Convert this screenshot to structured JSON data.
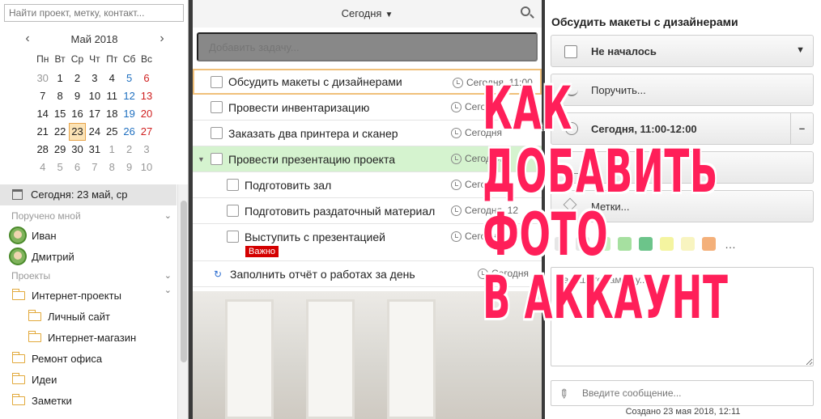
{
  "sidebar": {
    "search_placeholder": "Найти проект, метку, контакт...",
    "calendar": {
      "month_label": "Май 2018",
      "weekdays": [
        "Пн",
        "Вт",
        "Ср",
        "Чт",
        "Пт",
        "Сб",
        "Вс"
      ],
      "weeks": [
        [
          "30",
          "1",
          "2",
          "3",
          "4",
          "5",
          "6"
        ],
        [
          "7",
          "8",
          "9",
          "10",
          "11",
          "12",
          "13"
        ],
        [
          "14",
          "15",
          "16",
          "17",
          "18",
          "19",
          "20"
        ],
        [
          "21",
          "22",
          "23",
          "24",
          "25",
          "26",
          "27"
        ],
        [
          "28",
          "29",
          "30",
          "31",
          "1",
          "2",
          "3"
        ],
        [
          "4",
          "5",
          "6",
          "7",
          "8",
          "9",
          "10"
        ]
      ],
      "today": "23"
    },
    "today_label": "Сегодня: 23 май, ср",
    "assigned_section": "Поручено мной",
    "people": [
      "Иван",
      "Дмитрий"
    ],
    "projects_section": "Проекты",
    "projects": {
      "internet": "Интернет-проекты",
      "personal_site": "Личный сайт",
      "shop": "Интернет-магазин",
      "office": "Ремонт офиса",
      "ideas": "Идеи",
      "notes": "Заметки"
    }
  },
  "center": {
    "day_select": "Сегодня",
    "add_task_placeholder": "Добавить задачу...",
    "tasks": [
      {
        "title": "Обсудить макеты с дизайнерами",
        "time": "Сегодня, 11:00"
      },
      {
        "title": "Провести инвентаризацию",
        "time": "Сегодня"
      },
      {
        "title": "Заказать два принтера и сканер",
        "time": "Сегодня"
      },
      {
        "title": "Провести презентацию проекта",
        "time": "Сегодня"
      },
      {
        "title": "Подготовить зал",
        "time": "Сегодня"
      },
      {
        "title": "Подготовить раздаточный материал",
        "time": "Сегодня, 12"
      },
      {
        "title": "Выступить с презентацией",
        "time": "Сегодня",
        "badge": "Важно"
      },
      {
        "title": "Заполнить отчёт о работах за день",
        "time": "Сегодня"
      }
    ]
  },
  "detail": {
    "title": "Обсудить макеты с дизайнерами",
    "status": "Не началось",
    "assign": "Поручить...",
    "date": "Сегодня, 11:00-12:00",
    "tags": "Метки...",
    "note_placeholder": "Напишите заметку...",
    "message_placeholder": "Введите сообщение...",
    "created": "Создано 23 мая 2018, 12:11",
    "swatch_colors": [
      "#c8f0c0",
      "#a6e0a0",
      "#6cc48a",
      "#f4f4a0",
      "#f8f4c0",
      "#f4b07a"
    ]
  },
  "overlay": {
    "line1": "КАК",
    "line2": "ДОБАВИТЬ",
    "line3": "ФОТО",
    "line4": "В АККАУНТ",
    "color": "#ff1f59"
  }
}
